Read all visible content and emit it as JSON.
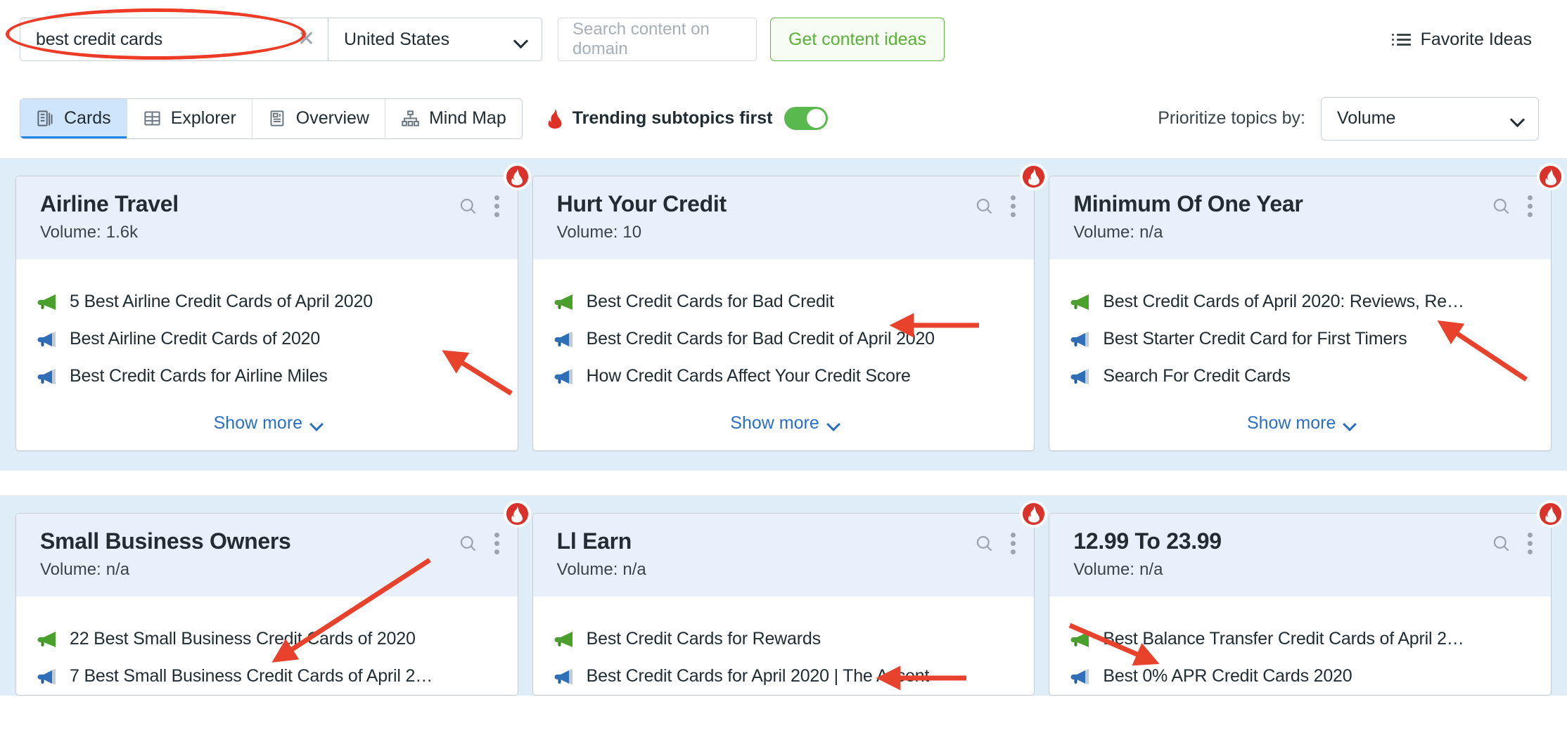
{
  "topbar": {
    "keyword_value": "best credit cards",
    "keyword_clear_label": "✕",
    "country_value": "United States",
    "domain_placeholder": "Search content on domain",
    "domain_value": "",
    "get_ideas_label": "Get content ideas",
    "favorite_ideas_label": "Favorite Ideas"
  },
  "toolbar": {
    "tabs": [
      {
        "label": "Cards",
        "icon": "cards-icon",
        "active": true
      },
      {
        "label": "Explorer",
        "icon": "table-icon",
        "active": false
      },
      {
        "label": "Overview",
        "icon": "article-icon",
        "active": false
      },
      {
        "label": "Mind Map",
        "icon": "mindmap-icon",
        "active": false
      }
    ],
    "trending_label": "Trending subtopics first",
    "trending_enabled": true,
    "prioritize_label": "Prioritize topics by:",
    "prioritize_value": "Volume"
  },
  "labels": {
    "volume_label": "Volume:",
    "show_more": "Show more"
  },
  "colors": {
    "accent_blue": "#1f85e8",
    "link_blue": "#2a6fc4",
    "green": "#5caf38",
    "toggle_green": "#5ab94e",
    "fire_red": "#d8322a",
    "annotation_red": "#ed3b26",
    "card_header_bg": "#e8f1fb",
    "row_band_bg": "#dfedf8"
  },
  "rows": [
    {
      "cards": [
        {
          "title": "Airline Travel",
          "volume": "1.6k",
          "trending": true,
          "show_more": true,
          "ideas": [
            {
              "text": "5 Best Airline Credit Cards of April 2020",
              "icon": "megaphone-green-icon"
            },
            {
              "text": "Best Airline Credit Cards of 2020",
              "icon": "megaphone-blue-icon"
            },
            {
              "text": "Best Credit Cards for Airline Miles",
              "icon": "megaphone-blue-icon"
            }
          ]
        },
        {
          "title": "Hurt Your Credit",
          "volume": "10",
          "trending": true,
          "show_more": true,
          "ideas": [
            {
              "text": "Best Credit Cards for Bad Credit",
              "icon": "megaphone-green-icon"
            },
            {
              "text": "Best Credit Cards for Bad Credit of April 2020",
              "icon": "megaphone-blue-icon"
            },
            {
              "text": "How Credit Cards Affect Your Credit Score",
              "icon": "megaphone-blue-icon"
            }
          ]
        },
        {
          "title": "Minimum Of One Year",
          "volume": "n/a",
          "trending": true,
          "show_more": true,
          "ideas": [
            {
              "text": "Best Credit Cards of April 2020: Reviews, Re…",
              "icon": "megaphone-green-icon"
            },
            {
              "text": "Best Starter Credit Card for First Timers",
              "icon": "megaphone-blue-icon"
            },
            {
              "text": "Search For Credit Cards",
              "icon": "megaphone-blue-icon"
            }
          ]
        }
      ]
    },
    {
      "cards": [
        {
          "title": "Small Business Owners",
          "volume": "n/a",
          "trending": true,
          "show_more": false,
          "ideas": [
            {
              "text": "22 Best Small Business Credit Cards of 2020",
              "icon": "megaphone-green-icon"
            },
            {
              "text": "7 Best Small Business Credit Cards of April 2…",
              "icon": "megaphone-blue-icon"
            }
          ]
        },
        {
          "title": "Ll Earn",
          "volume": "n/a",
          "trending": true,
          "show_more": false,
          "ideas": [
            {
              "text": "Best Credit Cards for Rewards",
              "icon": "megaphone-green-icon"
            },
            {
              "text": "Best Credit Cards for April 2020 | The Ascent",
              "icon": "megaphone-blue-icon"
            }
          ]
        },
        {
          "title": "12.99 To 23.99",
          "volume": "n/a",
          "trending": true,
          "show_more": false,
          "ideas": [
            {
              "text": "Best Balance Transfer Credit Cards of April 2…",
              "icon": "megaphone-green-icon"
            },
            {
              "text": "Best 0% APR Credit Cards 2020",
              "icon": "megaphone-blue-icon"
            }
          ]
        }
      ]
    }
  ]
}
